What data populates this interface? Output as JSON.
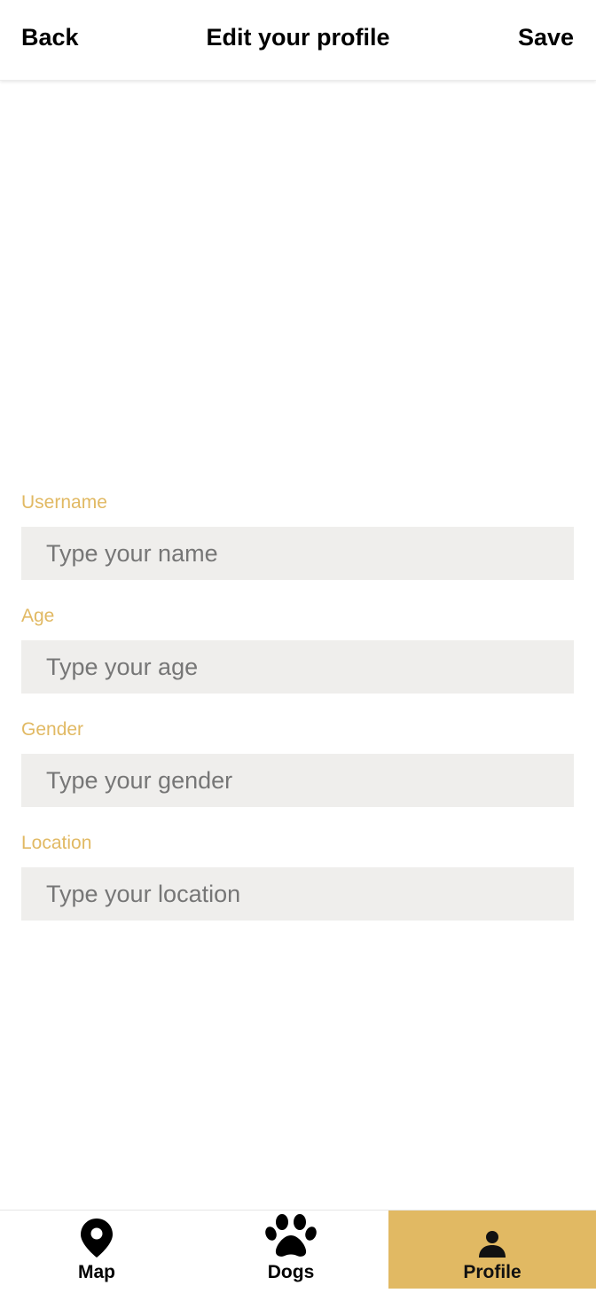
{
  "header": {
    "back_label": "Back",
    "title": "Edit your profile",
    "save_label": "Save"
  },
  "form": {
    "fields": [
      {
        "label": "Username",
        "placeholder": "Type your name",
        "value": ""
      },
      {
        "label": "Age",
        "placeholder": "Type your age",
        "value": ""
      },
      {
        "label": "Gender",
        "placeholder": "Type your gender",
        "value": ""
      },
      {
        "label": "Location",
        "placeholder": "Type your location",
        "value": ""
      }
    ]
  },
  "tabbar": {
    "tabs": [
      {
        "label": "Map",
        "icon": "map-pin-icon",
        "active": false
      },
      {
        "label": "Dogs",
        "icon": "paw-icon",
        "active": false
      },
      {
        "label": "Profile",
        "icon": "person-icon",
        "active": true
      }
    ]
  },
  "colors": {
    "accent": "#e1b963",
    "input_background": "#efeeec",
    "text": "#000000",
    "placeholder": "#767676"
  }
}
